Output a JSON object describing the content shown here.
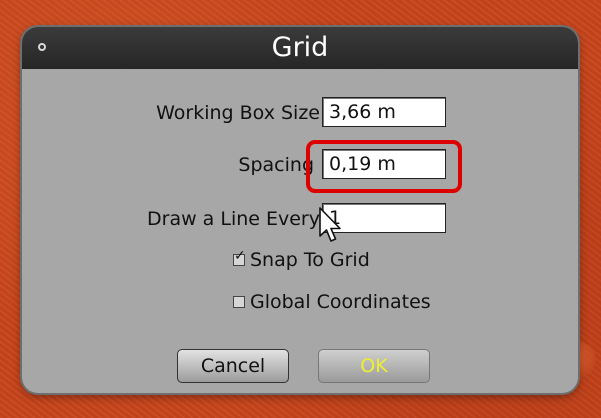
{
  "dialog": {
    "title": "Grid",
    "fields": {
      "working_box_size": {
        "label": "Working Box Size",
        "value": "3,66 m"
      },
      "spacing": {
        "label": "Spacing",
        "value": "0,19 m"
      },
      "draw_line_every": {
        "label": "Draw a Line Every",
        "value": "1"
      }
    },
    "checkboxes": {
      "snap_to_grid": {
        "label": "Snap To Grid",
        "checked": true
      },
      "global_coordinates": {
        "label": "Global Coordinates",
        "checked": false
      }
    },
    "buttons": {
      "cancel": "Cancel",
      "ok": "OK"
    }
  },
  "colors": {
    "background": "#c8451c",
    "dialog_body": "#a7a7a7",
    "titlebar": "#2e2e2e",
    "highlight": "#dd0000",
    "ok_text": "#eeee33"
  },
  "icons": {
    "title_dot": "circle-dot-icon",
    "check": "checkmark-icon",
    "cursor": "mouse-pointer-icon"
  }
}
